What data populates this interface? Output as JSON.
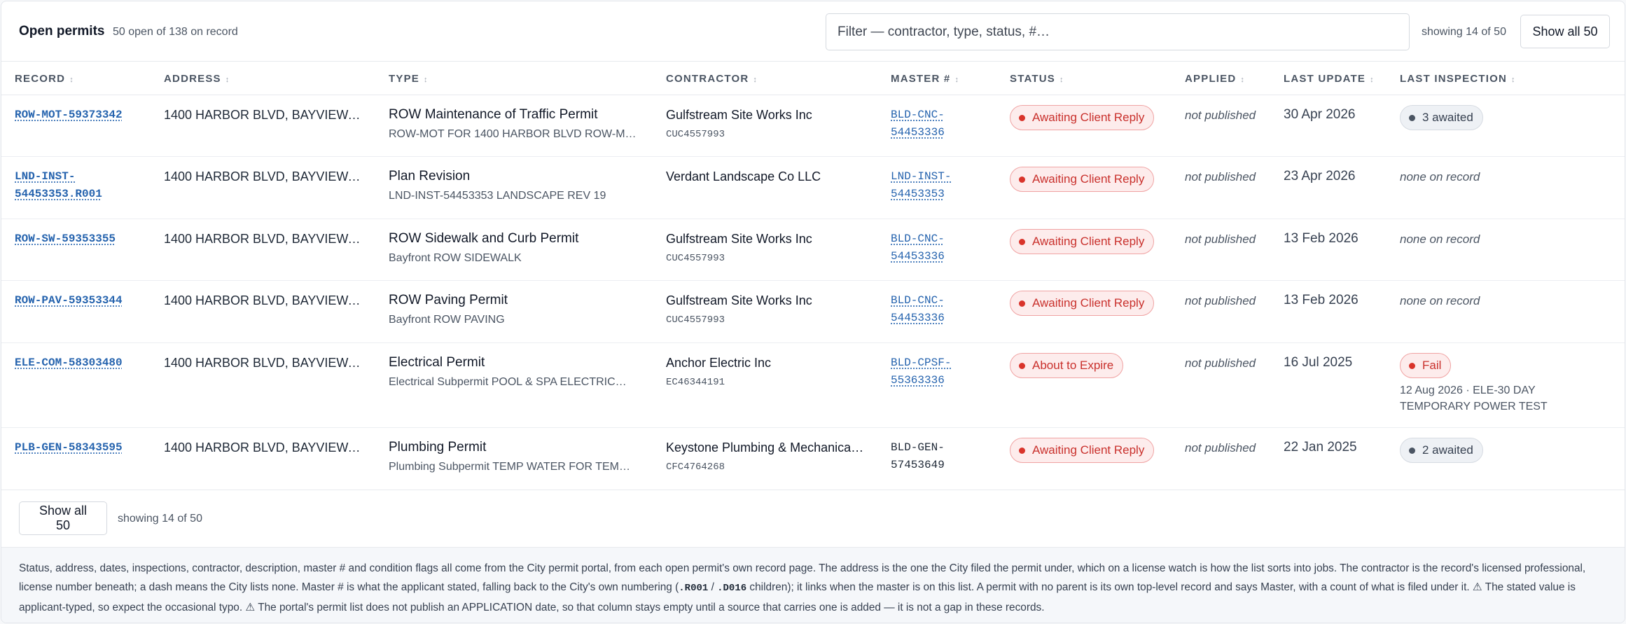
{
  "header": {
    "title": "Open permits",
    "subtitle": "50 open of 138 on record",
    "filter_placeholder": "Filter — contractor, type, status, #…",
    "showing": "showing 14 of 50",
    "show_all_label": "Show all 50"
  },
  "columns": [
    "RECORD",
    "ADDRESS",
    "TYPE",
    "CONTRACTOR",
    "MASTER #",
    "STATUS",
    "APPLIED",
    "LAST UPDATE",
    "LAST INSPECTION"
  ],
  "sort_glyph": "↕",
  "rows": [
    {
      "record": "ROW-MOT-59373342",
      "address": "1400 HARBOR BLVD, BAYVIEW, …",
      "type": "ROW Maintenance of Traffic Permit",
      "type_sub": "ROW-MOT FOR 1400 HARBOR BLVD ROW-M…",
      "contractor": "Gulfstream Site Works Inc",
      "license": "CUC4557993",
      "master": [
        "BLD-CNC-",
        "54453336"
      ],
      "status": "Awaiting Client Reply",
      "applied": "not published",
      "last_update": "30 Apr 2026",
      "inspection": "3 awaited",
      "inspection_note": ""
    },
    {
      "record": "LND-INST-54453353.R001",
      "address": "1400 HARBOR BLVD, BAYVIEW, …",
      "type": "Plan Revision",
      "type_sub": "LND-INST-54453353 LANDSCAPE REV 19",
      "contractor": "Verdant Landscape Co LLC",
      "license": "",
      "master": [
        "LND-INST-",
        "54453353"
      ],
      "status": "Awaiting Client Reply",
      "applied": "not published",
      "last_update": "23 Apr 2026",
      "inspection": "none on record",
      "inspection_note": ""
    },
    {
      "record": "ROW-SW-59353355",
      "address": "1400 HARBOR BLVD, BAYVIEW, …",
      "type": "ROW Sidewalk and Curb Permit",
      "type_sub": "Bayfront ROW SIDEWALK",
      "contractor": "Gulfstream Site Works Inc",
      "license": "CUC4557993",
      "master": [
        "BLD-CNC-",
        "54453336"
      ],
      "status": "Awaiting Client Reply",
      "applied": "not published",
      "last_update": "13 Feb 2026",
      "inspection": "none on record",
      "inspection_note": ""
    },
    {
      "record": "ROW-PAV-59353344",
      "address": "1400 HARBOR BLVD, BAYVIEW, …",
      "type": "ROW Paving Permit",
      "type_sub": "Bayfront ROW PAVING",
      "contractor": "Gulfstream Site Works Inc",
      "license": "CUC4557993",
      "master": [
        "BLD-CNC-",
        "54453336"
      ],
      "status": "Awaiting Client Reply",
      "applied": "not published",
      "last_update": "13 Feb 2026",
      "inspection": "none on record",
      "inspection_note": ""
    },
    {
      "record": "ELE-COM-58303480",
      "address": "1400 HARBOR BLVD, BAYVIEW, …",
      "type": "Electrical Permit",
      "type_sub": "Electrical Subpermit POOL & SPA ELECTRIC…",
      "contractor": "Anchor Electric Inc",
      "license": "EC46344191",
      "master": [
        "BLD-CPSF-",
        "55363336"
      ],
      "status": "About to Expire",
      "applied": "not published",
      "last_update": "16 Jul 2025",
      "inspection": "Fail",
      "inspection_note": "12 Aug 2026 · ELE-30 DAY TEMPORARY POWER TEST"
    },
    {
      "record": "PLB-GEN-58343595",
      "address": "1400 HARBOR BLVD, BAYVIEW, …",
      "type": "Plumbing Permit",
      "type_sub": "Plumbing Subpermit TEMP WATER FOR TEM…",
      "contractor": "Keystone Plumbing & Mechanica…",
      "license": "CFC4764268",
      "master": [
        "BLD-GEN-",
        "57453649"
      ],
      "status": "Awaiting Client Reply",
      "applied": "not published",
      "last_update": "22 Jan 2025",
      "inspection": "2 awaited",
      "inspection_note": ""
    }
  ],
  "footer": {
    "showing": "showing 14 of 50",
    "show_all_label": "Show all 50",
    "note_a": "Status, address, dates, inspections, contractor, description, master # and condition flags all come from the City permit portal, from each open permit's own record page. The address is the one the City filed the permit under, which on a license watch is how the list sorts into jobs. The contractor is the record's licensed professional, license number beneath; a dash means the City lists none. Master # is what the applicant stated, falling back to the City's own numbering (",
    "code_1": ".R001",
    "note_sep": " / ",
    "code_2": ".D016",
    "note_b": " children); it links when the master is on this list. A permit with no parent is its own top-level record and says Master, with a count of what is filed under it. ⚠ The stated value is applicant-typed, so expect the occasional typo. ⚠ The portal's permit list does not publish an APPLICATION date, so that column stays empty until a source that carries one is added — it is not a gap in these records."
  },
  "colors": {
    "link": "#2563ae",
    "danger": "#c9302c",
    "danger_bg": "#fdecec",
    "neutral_badge_bg": "#eef1f5"
  }
}
